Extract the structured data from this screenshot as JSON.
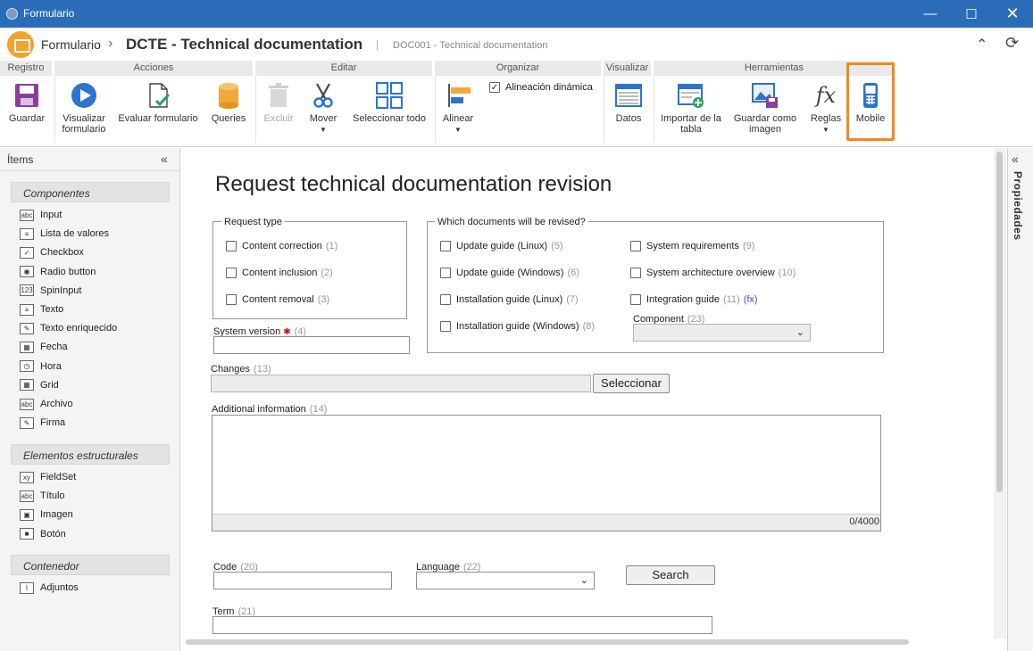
{
  "window": {
    "title": "Formulario"
  },
  "header": {
    "section": "Formulario",
    "title": "DCTE - Technical documentation",
    "subtitle": "DOC001 - Technical documentation"
  },
  "ribbon": {
    "groups": [
      "Registro",
      "Acciones",
      "Editar",
      "Organizar",
      "Visualizar",
      "Herramientas"
    ],
    "buttons": {
      "guardar": "Guardar",
      "visualizar1": "Visualizar",
      "visualizar2": "formulario",
      "evaluar": "Evaluar formulario",
      "queries": "Queries",
      "excluir": "Excluir",
      "mover": "Mover",
      "seleccionar_todo": "Seleccionar todo",
      "alineacion": "Alineación dinámica",
      "alinear": "Alinear",
      "datos": "Datos",
      "importar1": "Importar de la",
      "importar2": "tabla",
      "guardar_img1": "Guardar como",
      "guardar_img2": "imagen",
      "reglas": "Reglas",
      "mobile": "Mobile"
    },
    "highlight_color": "#f08a1c"
  },
  "left_panel": {
    "title": "Ítems",
    "sections": {
      "componentes": "Componentes",
      "estructurales": "Elementos estructurales",
      "contenedor": "Contenedor"
    },
    "componentes": [
      {
        "icon": "abc",
        "label": "Input"
      },
      {
        "icon": "≡",
        "label": "Lista de valores"
      },
      {
        "icon": "✓",
        "label": "Checkbox"
      },
      {
        "icon": "◉",
        "label": "Radio button"
      },
      {
        "icon": "123",
        "label": "SpinInput"
      },
      {
        "icon": "≡",
        "label": "Texto"
      },
      {
        "icon": "✎",
        "label": "Texto enriquecido"
      },
      {
        "icon": "▦",
        "label": "Fecha"
      },
      {
        "icon": "◷",
        "label": "Hora"
      },
      {
        "icon": "▦",
        "label": "Grid"
      },
      {
        "icon": "abc",
        "label": "Archivo"
      },
      {
        "icon": "✎",
        "label": "Firma"
      }
    ],
    "estructurales": [
      {
        "icon": "xy",
        "label": "FieldSet"
      },
      {
        "icon": "abc",
        "label": "Título"
      },
      {
        "icon": "▣",
        "label": "Imagen"
      },
      {
        "icon": "■",
        "label": "Botón"
      }
    ],
    "contenedor": [
      {
        "icon": "⌇",
        "label": "Adjuntos"
      }
    ]
  },
  "right_panel": {
    "label": "Propiedades"
  },
  "form": {
    "title": "Request technical documentation revision",
    "request_type": {
      "legend": "Request type",
      "items": [
        {
          "label": "Content correction",
          "num": "(1)"
        },
        {
          "label": "Content inclusion",
          "num": "(2)"
        },
        {
          "label": "Content removal",
          "num": "(3)"
        }
      ]
    },
    "documents": {
      "legend": "Which documents will be revised?",
      "col1": [
        {
          "label": "Update guide (Linux)",
          "num": "(5)"
        },
        {
          "label": "Update guide (Windows)",
          "num": "(6)"
        },
        {
          "label": "Installation guide (Linux)",
          "num": "(7)"
        },
        {
          "label": "Installation guide (Windows)",
          "num": "(8)"
        }
      ],
      "col2": [
        {
          "label": "System requirements",
          "num": "(9)"
        },
        {
          "label": "System architecture overview",
          "num": "(10)"
        },
        {
          "label": "Integration guide",
          "num": "(11)",
          "fx": "(fx)"
        }
      ],
      "component_label": "Component",
      "component_num": "(23)"
    },
    "system_version": {
      "label": "System version",
      "num": "(4)"
    },
    "changes": {
      "label": "Changes",
      "num": "(13)",
      "button": "Seleccionar"
    },
    "additional": {
      "label": "Additional information",
      "num": "(14)",
      "counter": "0/4000"
    },
    "code": {
      "label": "Code",
      "num": "(20)"
    },
    "language": {
      "label": "Language",
      "num": "(22)"
    },
    "search_button": "Search",
    "term": {
      "label": "Term",
      "num": "(21)"
    }
  }
}
